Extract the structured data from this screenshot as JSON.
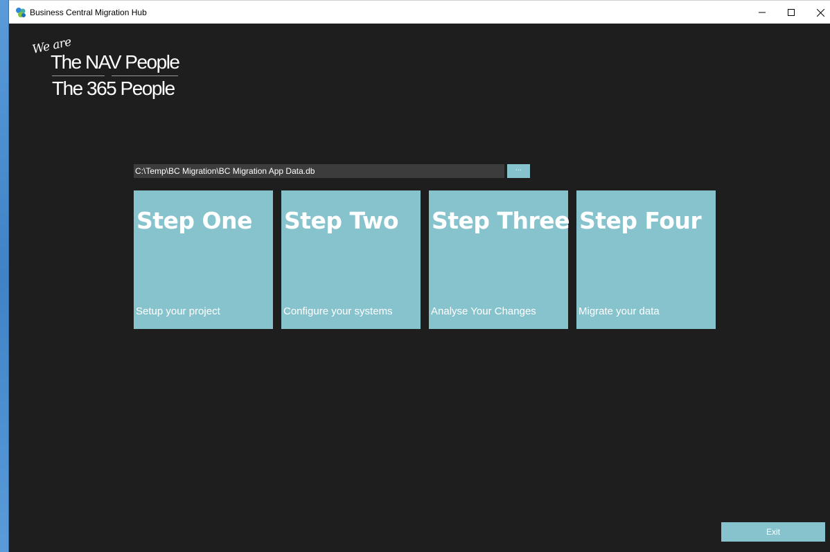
{
  "window": {
    "title": "Business Central Migration Hub",
    "icon": "app-logo-icon",
    "controls": [
      "minimize-icon",
      "maximize-icon",
      "close-icon"
    ]
  },
  "logo": {
    "we_are": "We are",
    "line1": "The NAV People",
    "line2": "The 365 People"
  },
  "database": {
    "path": "C:\\Temp\\BC Migration\\BC Migration App Data.db",
    "browse_label": "..."
  },
  "steps": [
    {
      "title": "Step One",
      "subtitle": "Setup your project"
    },
    {
      "title": "Step Two",
      "subtitle": "Configure your systems"
    },
    {
      "title": "Step Three",
      "subtitle": "Analyse Your Changes"
    },
    {
      "title": "Step Four",
      "subtitle": "Migrate your data"
    }
  ],
  "footer": {
    "exit_label": "Exit"
  },
  "colors": {
    "background": "#1e1e1e",
    "accent": "#87c3cd",
    "input_bg": "#3c3c3c"
  }
}
